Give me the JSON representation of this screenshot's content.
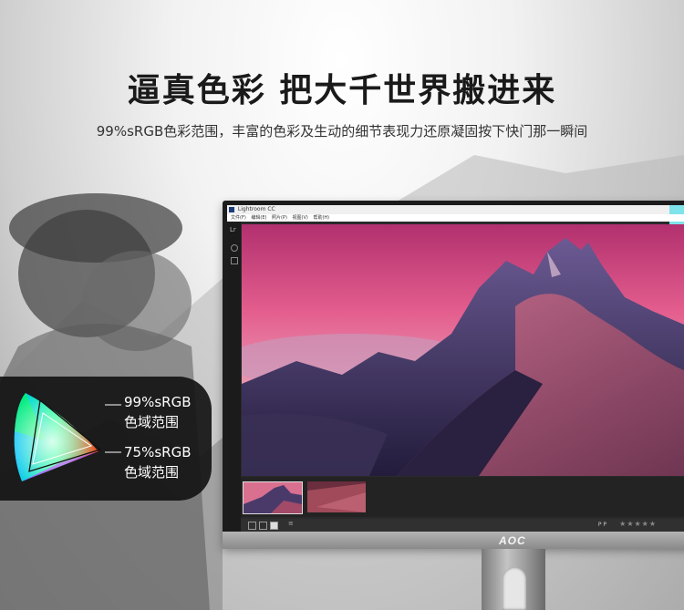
{
  "headline": "逼真色彩 把大千世界搬进来",
  "subline": "99%sRGB色彩范围，丰富的色彩及生动的细节表现力还原凝固按下快门那一瞬间",
  "app": {
    "title": "Lightroom CC",
    "menu": [
      "文件(F)",
      "编辑(E)",
      "照片(P)",
      "视图(V)",
      "帮助(H)"
    ],
    "module_mark": "Lr",
    "rating_stars": "★★★★★",
    "flag_label": "P P"
  },
  "monitor": {
    "brand_logo": "AOC"
  },
  "gamut": {
    "srgb99_value": "99%sRGB",
    "srgb99_caption": "色域范围",
    "srgb75_value": "75%sRGB",
    "srgb75_caption": "色域范围"
  },
  "colors": {
    "sky_top": "#d23a78",
    "sky_mid": "#ea7aa0",
    "mountain": "#3b2f5e",
    "card_bg": "#141414"
  }
}
